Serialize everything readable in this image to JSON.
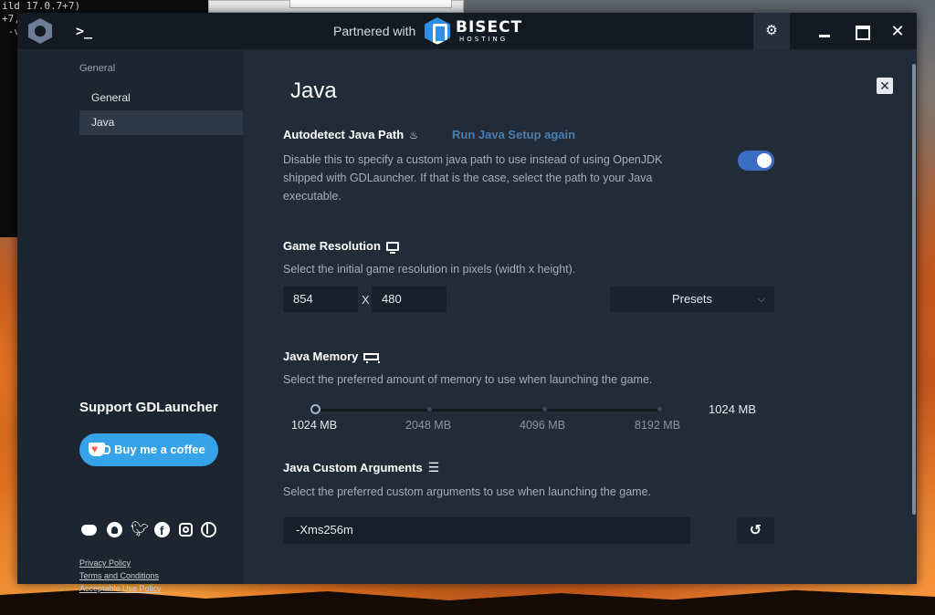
{
  "background": {
    "terminal_lines": [
      "ild 17.0.7+7)",
      "+7,",
      " -v"
    ]
  },
  "titlebar": {
    "partnered_label": "Partnered with",
    "partner_name": "BISECT",
    "partner_sub": "HOSTING",
    "icons": [
      "launcher-logo-icon",
      "terminal-icon",
      "gear-icon",
      "minimize-icon",
      "maximize-icon",
      "close-icon"
    ],
    "close_glyph": "✕"
  },
  "sidebar": {
    "section_title": "General",
    "items": [
      {
        "label": "General",
        "selected": false
      },
      {
        "label": "Java",
        "selected": true
      }
    ],
    "support_title": "Support GDLauncher",
    "coffee_label": "Buy me a coffee",
    "social_icons": [
      "discord-icon",
      "github-icon",
      "twitter-icon",
      "facebook-icon",
      "instagram-icon",
      "website-icon"
    ],
    "legal_links": [
      "Privacy Policy",
      "Terms and Conditions",
      "Acceptable Use Policy"
    ]
  },
  "main": {
    "title": "Java",
    "close_glyph": "✕",
    "autodetect": {
      "heading": "Autodetect Java Path",
      "icon": "java-cup-icon",
      "link": "Run Java Setup again",
      "description_lines": [
        "Disable this to specify a custom java path to use instead of using OpenJDK",
        "shipped with GDLauncher. If that is the case, select the path to your Java",
        "executable."
      ],
      "enabled": true
    },
    "resolution": {
      "heading": "Game Resolution",
      "icon": "monitor-icon",
      "description": "Select the initial game resolution in pixels (width x height).",
      "width": "854",
      "separator": "X",
      "height": "480",
      "presets_label": "Presets",
      "presets_chevron": "⌵"
    },
    "memory": {
      "heading": "Java Memory",
      "icon": "ram-icon",
      "description": "Select the preferred amount of memory to use when launching the game.",
      "marks": [
        "1024 MB",
        "2048 MB",
        "4096 MB",
        "8192 MB"
      ],
      "current_value": "1024 MB",
      "slider_level": 0
    },
    "arguments": {
      "heading": "Java Custom Arguments",
      "icon": "list-icon",
      "description": "Select the preferred custom arguments to use when launching the game.",
      "value": "-Xms256m",
      "reset_glyph": "↺"
    }
  },
  "colors": {
    "accent": "#3d6cc4",
    "link": "#4a7cb0",
    "coffee": "#36a3e8",
    "bisect_blue": "#2f8ee5"
  }
}
